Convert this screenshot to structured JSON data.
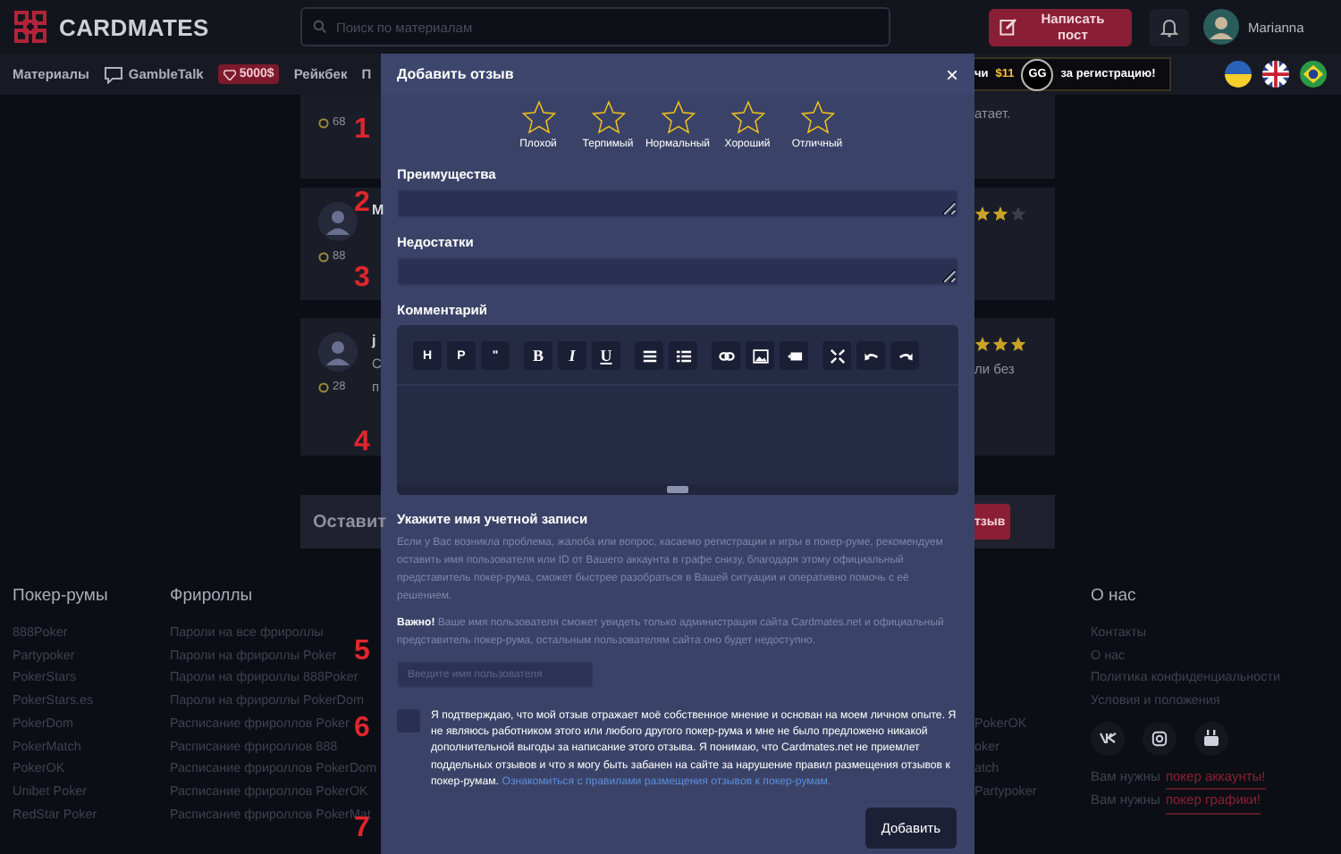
{
  "header": {
    "logo": "CARDMATES",
    "search": {
      "placeholder": "Поиск по материалам"
    },
    "write_button": "Написать пост",
    "user": "Marianna"
  },
  "nav": {
    "items": [
      {
        "kind": "text",
        "label": "Материалы"
      },
      {
        "kind": "chat",
        "label": "GambleTalk"
      },
      {
        "kind": "badge",
        "label": "5000$"
      },
      {
        "kind": "text",
        "label": "Рейкбек"
      },
      {
        "kind": "text",
        "label": "П"
      }
    ],
    "promo": {
      "start": "чи",
      "amount": "$11",
      "logo": "GG",
      "end": "за регистрацию!"
    }
  },
  "reviews": [
    {
      "score": "68",
      "right_lines": [
        "атает."
      ]
    },
    {
      "score": "88",
      "name": "М",
      "avatar": true,
      "stars": 2
    },
    {
      "score": "28",
      "name": "j",
      "avatar": true,
      "left_lines": [
        "С",
        "п"
      ],
      "stars": 3,
      "right_lines": [
        "ли без"
      ]
    }
  ],
  "cta": {
    "left": "Оставит",
    "right": "тзыв"
  },
  "modal": {
    "title": "Добавить отзыв",
    "close": "×",
    "rating": {
      "stars": 0,
      "labels": [
        "Плохой",
        "Терпимый",
        "Нормальный",
        "Хороший",
        "Отличный"
      ]
    },
    "pros": {
      "label": "Преимущества"
    },
    "cons": {
      "label": "Недостатки"
    },
    "comment": {
      "label": "Комментарий",
      "toolbar_groups": [
        {
          "buttons": [
            {
              "kind": "label",
              "label": "H"
            },
            {
              "kind": "label",
              "label": "P"
            },
            {
              "kind": "label",
              "label": "\""
            }
          ]
        },
        {
          "buttons": [
            {
              "kind": "bold",
              "label": "B"
            },
            {
              "kind": "italic",
              "label": "I"
            },
            {
              "kind": "underline",
              "label": "U"
            }
          ]
        },
        {
          "buttons": [
            {
              "kind": "bullet-list"
            },
            {
              "kind": "numbered-list"
            }
          ]
        },
        {
          "buttons": [
            {
              "kind": "link"
            },
            {
              "kind": "image"
            },
            {
              "kind": "video"
            }
          ]
        },
        {
          "buttons": [
            {
              "kind": "fullscreen"
            },
            {
              "kind": "undo"
            },
            {
              "kind": "redo"
            }
          ]
        }
      ]
    },
    "account": {
      "title": "Укажите имя учетной записи",
      "info": "Если у Вас возникла проблема, жалоба или вопрос, касаемо регистрации и игры в покер-руме, рекомендуем оставить имя пользователя или ID от Вашего аккаунта в графе снизу, благодаря этому официальный представитель покер-рума, сможет быстрее разобраться в Вашей ситуации и оперативно помочь с её решением.",
      "notice": "**Важно!** Ваше имя пользователя сможет увидеть только администрация сайта Cardmates.net и официальный представитель покер-рума, остальным пользователям сайта оно будет недоступно.",
      "placeholder": "Введите имя пользователя"
    },
    "consent": {
      "checked": false,
      "text": "Я подтверждаю, что мой отзыв отражает моё собственное мнение и основан на моем личном опыте. Я не являюсь работником этого или любого другого покер-рума и мне не было предложено никакой дополнительной выгоды за написание этого отзыва. Я понимаю, что Cardmates.net не приемлет поддельных отзывов и что я могу быть забанен на сайте за нарушение правил размещения отзывов к покер-румам.",
      "link": "Ознакомиться с правилами размещения отзывов к покер-румам."
    },
    "submit": "Добавить"
  },
  "footer": {
    "poker_rooms": {
      "title": "Покер-румы",
      "items": [
        "888Poker",
        "Partypoker",
        "PokerStars",
        "PokerStars.es",
        "PokerDom",
        "PokerMatch",
        "PokerOK",
        "Unibet Poker",
        "RedStar Poker"
      ]
    },
    "freerolls": {
      "title": "Фрироллы",
      "items": [
        "Пароли на все фрироллы",
        "Пароли на фрироллы Poker",
        "Пароли на фрироллы 888Poker",
        "Пароли на фрироллы PokerDom",
        "Расписание фрироллов Poker",
        "Расписание фрироллов 888",
        "Расписание фрироллов PokerDom",
        "Расписание фрироллов PokerOK",
        "Расписание фрироллов PokerMat"
      ]
    },
    "column_3": {
      "items": [
        "PokerOK",
        "oker",
        "atch",
        "Partypoker"
      ]
    },
    "about": {
      "title": "О нас",
      "items": [
        "Контакты",
        "О нас",
        "Политика конфиденциальности",
        "Условия и положения"
      ]
    },
    "promos": [
      {
        "text": "Вам нужны",
        "link": "покер аккаунты!"
      },
      {
        "text": "Вам нужны",
        "link": "покер графики!"
      }
    ]
  },
  "annotations": [
    "1",
    "2",
    "3",
    "4",
    "5",
    "6",
    "7"
  ]
}
